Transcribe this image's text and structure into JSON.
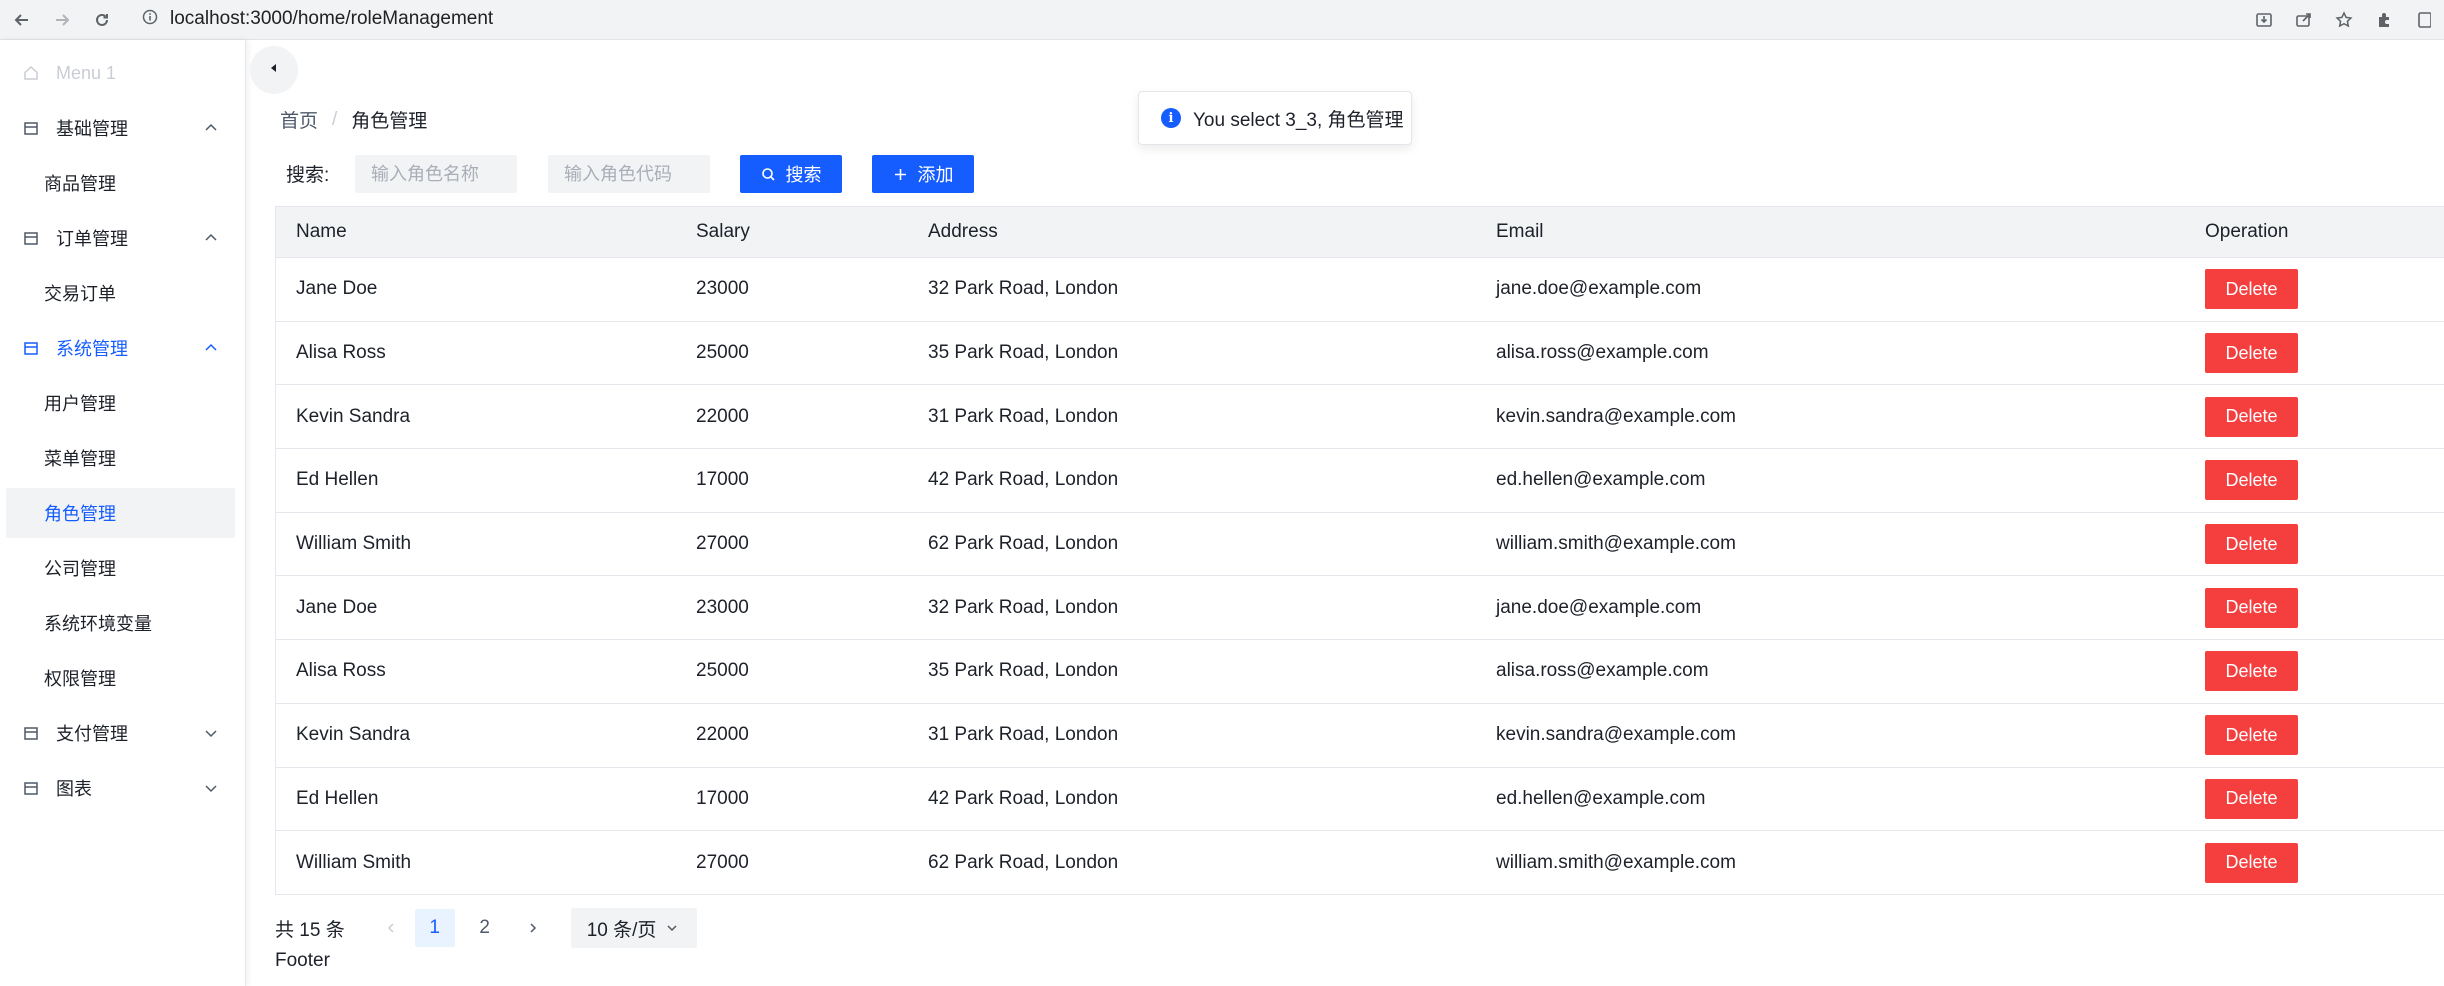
{
  "browser": {
    "url": "localhost:3000/home/roleManagement"
  },
  "sidebar": {
    "menu1": "Menu 1",
    "groups": [
      {
        "label": "基础管理",
        "children": [
          "商品管理"
        ]
      },
      {
        "label": "订单管理",
        "children": [
          "交易订单"
        ]
      },
      {
        "label": "系统管理",
        "children": [
          "用户管理",
          "菜单管理",
          "角色管理",
          "公司管理",
          "系统环境变量",
          "权限管理"
        ]
      },
      {
        "label": "支付管理"
      },
      {
        "label": "图表"
      }
    ],
    "selected_item": "角色管理",
    "active_color": "#165dff"
  },
  "breadcrumb": {
    "home": "首页",
    "separator": "/",
    "current": "角色管理"
  },
  "toast": {
    "message": "You select 3_3, 角色管理"
  },
  "search": {
    "label": "搜索:",
    "name_placeholder": "输入角色名称",
    "code_placeholder": "输入角色代码",
    "search_button": "搜索",
    "add_button": "添加"
  },
  "table": {
    "headers": [
      "Name",
      "Salary",
      "Address",
      "Email",
      "Operation"
    ],
    "rows": [
      {
        "name": "Jane Doe",
        "salary": "23000",
        "address": "32 Park Road, London",
        "email": "jane.doe@example.com",
        "op": "Delete"
      },
      {
        "name": "Alisa Ross",
        "salary": "25000",
        "address": "35 Park Road, London",
        "email": "alisa.ross@example.com",
        "op": "Delete"
      },
      {
        "name": "Kevin Sandra",
        "salary": "22000",
        "address": "31 Park Road, London",
        "email": "kevin.sandra@example.com",
        "op": "Delete"
      },
      {
        "name": "Ed Hellen",
        "salary": "17000",
        "address": "42 Park Road, London",
        "email": "ed.hellen@example.com",
        "op": "Delete"
      },
      {
        "name": "William Smith",
        "salary": "27000",
        "address": "62 Park Road, London",
        "email": "william.smith@example.com",
        "op": "Delete"
      },
      {
        "name": "Jane Doe",
        "salary": "23000",
        "address": "32 Park Road, London",
        "email": "jane.doe@example.com",
        "op": "Delete"
      },
      {
        "name": "Alisa Ross",
        "salary": "25000",
        "address": "35 Park Road, London",
        "email": "alisa.ross@example.com",
        "op": "Delete"
      },
      {
        "name": "Kevin Sandra",
        "salary": "22000",
        "address": "31 Park Road, London",
        "email": "kevin.sandra@example.com",
        "op": "Delete"
      },
      {
        "name": "Ed Hellen",
        "salary": "17000",
        "address": "42 Park Road, London",
        "email": "ed.hellen@example.com",
        "op": "Delete"
      },
      {
        "name": "William Smith",
        "salary": "27000",
        "address": "62 Park Road, London",
        "email": "william.smith@example.com",
        "op": "Delete"
      }
    ],
    "delete_color": "#f53f3f"
  },
  "pagination": {
    "total": "共 15 条",
    "pages": [
      "1",
      "2"
    ],
    "current_page": "1",
    "page_size": "10 条/页"
  },
  "footer": {
    "text": "Footer"
  }
}
